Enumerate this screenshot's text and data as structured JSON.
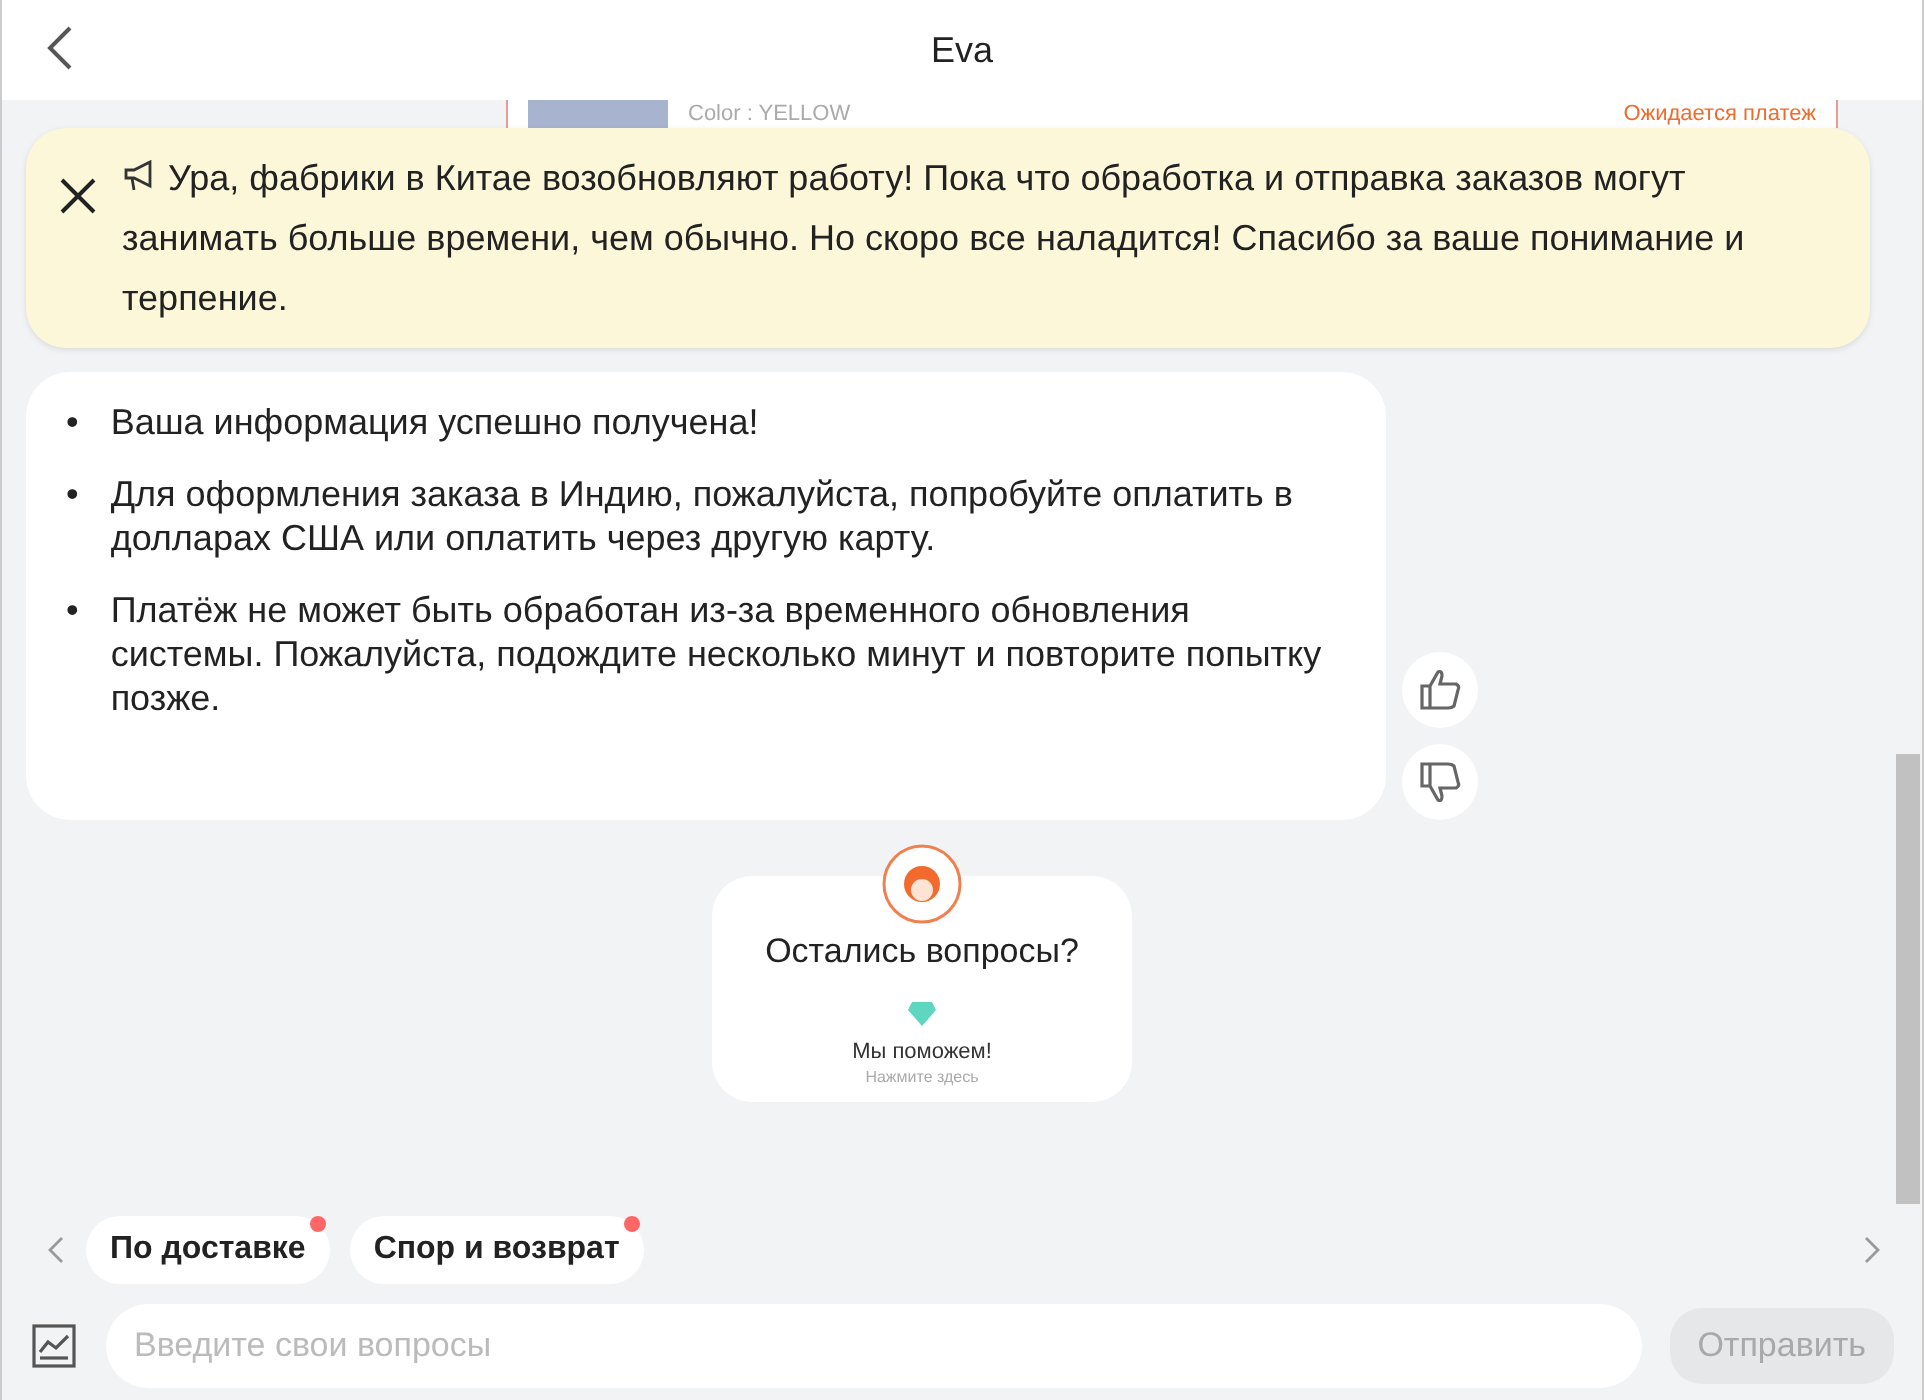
{
  "header": {
    "title": "Eva"
  },
  "order_card": {
    "color_text": "Color : YELLOW",
    "status": "Ожидается платеж"
  },
  "notice": {
    "text": "Ура, фабрики в Китае возобновляют работу! Пока что обработка и отправка заказов могут занимать больше времени, чем обычно. Но скоро все наладится! Спасибо за ваше понимание и терпение."
  },
  "message": {
    "bullet": "•",
    "items": [
      "Ваша информация успешно получена!",
      "Для оформления заказа в Индию, пожалуйста, попробуйте оплатить в долларах США или оплатить через другую карту.",
      "Платёж не может быть обработан из-за временного обновления системы. Пожалуйста, подождите несколько минут и повторите попытку позже."
    ]
  },
  "help_card": {
    "title": "Остались вопросы?",
    "subtitle": "Мы поможем!",
    "hint": "Нажмите здесь"
  },
  "quick_topics": [
    {
      "label": "По доставке",
      "unread": true
    },
    {
      "label": "Спор и возврат",
      "unread": true
    }
  ],
  "composer": {
    "placeholder": "Введите свои вопросы",
    "send_label": "Отправить",
    "send_disabled": true
  }
}
